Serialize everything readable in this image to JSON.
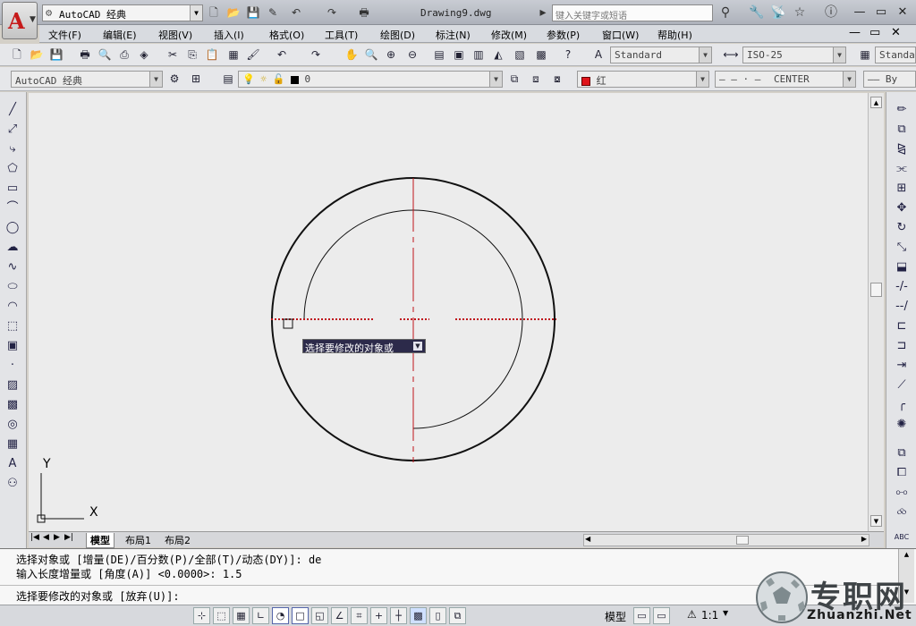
{
  "app": {
    "logo": "A",
    "workspace": "AutoCAD 经典",
    "doc_title": "Drawing9.dwg",
    "search_placeholder": "键入关键字或短语"
  },
  "menu": [
    "文件(F)",
    "编辑(E)",
    "视图(V)",
    "插入(I)",
    "格式(O)",
    "工具(T)",
    "绘图(D)",
    "标注(N)",
    "修改(M)",
    "参数(P)",
    "窗口(W)",
    "帮助(H)"
  ],
  "styles": {
    "text_style": "Standard",
    "dim_style": "ISO-25",
    "table_style": "Standa"
  },
  "layers": {
    "workspace": "AutoCAD 经典",
    "current_layer": "0",
    "color": "红",
    "linetype": "CENTER",
    "lineweight": "By"
  },
  "tabs": [
    "模型",
    "布局1",
    "布局2"
  ],
  "tooltip": "选择要修改的对象或",
  "command": {
    "history_1": "选择对象或 [增量(DE)/百分数(P)/全部(T)/动态(DY)]: de",
    "history_2": "输入长度增量或 [角度(A)] <0.0000>: 1.5",
    "prompt": "选择要修改的对象或 [放弃(U)]:"
  },
  "status": {
    "model": "模型",
    "scale": "1:1"
  },
  "ucs": {
    "x": "X",
    "y": "Y"
  },
  "watermark": {
    "main": "专职网",
    "sub": "Zhuanzhi.Net"
  },
  "colors": {
    "centerline": "#c0141a",
    "layer_color": "#e0141a",
    "canvas": "#ececec",
    "tooltip_bg": "#2c2a4a"
  }
}
